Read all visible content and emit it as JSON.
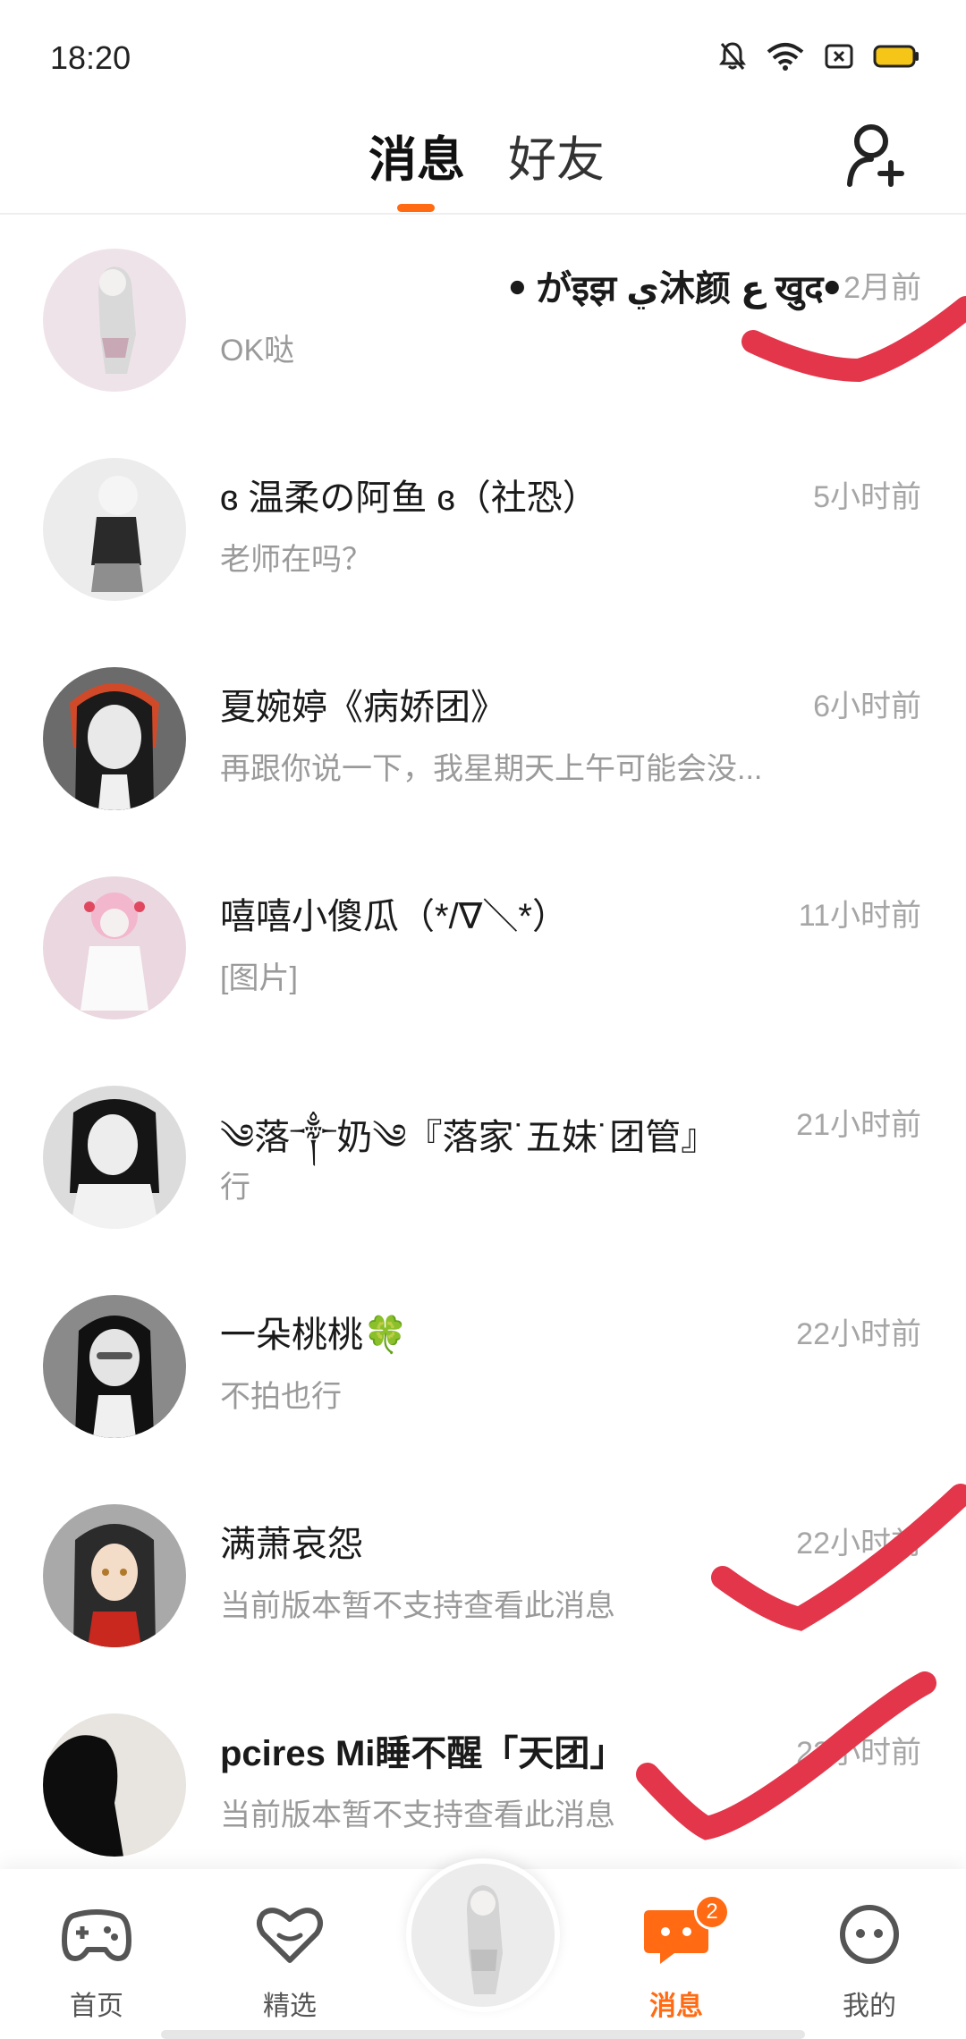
{
  "status_bar": {
    "time": "18:20"
  },
  "header": {
    "tabs": [
      {
        "label": "消息",
        "active": true
      },
      {
        "label": "好友",
        "active": false
      }
    ],
    "accent_color": "#ff6a13",
    "add_friend_icon": "person-add-icon"
  },
  "conversations": [
    {
      "name": "ꔷ がइझ ي沐颜 ع खुदꔷ",
      "preview": "OK哒",
      "time": "2月前"
    },
    {
      "name": "ɞ 温柔の阿鱼 ɞ（社恐）",
      "preview": "老师在吗？",
      "time": "5小时前"
    },
    {
      "name": "夏婉婷《病娇团》",
      "preview": "再跟你说一下，我星期天上午可能会没...",
      "time": "6小时前"
    },
    {
      "name": "嘻嘻小傻瓜（*/∇＼*）",
      "preview": "[图片]",
      "time": "11小时前"
    },
    {
      "name": "༄落༒奶༄『落家˙五妹˙团管』",
      "preview": "行",
      "time": "21小时前"
    },
    {
      "name": "一朵桃桃🍀",
      "preview": "不拍也行",
      "time": "22小时前"
    },
    {
      "name": "满萧哀怨",
      "preview": "当前版本暂不支持查看此消息",
      "time": "22小时前"
    },
    {
      "name": "pcires Mi睡不醒「天团」",
      "preview": "当前版本暂不支持查看此消息",
      "time": "23小时前"
    }
  ],
  "bottom_nav": {
    "items": [
      {
        "label": "首页",
        "icon": "gamepad-icon"
      },
      {
        "label": "精选",
        "icon": "heart-icon"
      },
      {
        "label": "消息",
        "icon": "chat-icon",
        "active": true,
        "badge": "2"
      },
      {
        "label": "我的",
        "icon": "face-icon"
      }
    ]
  }
}
